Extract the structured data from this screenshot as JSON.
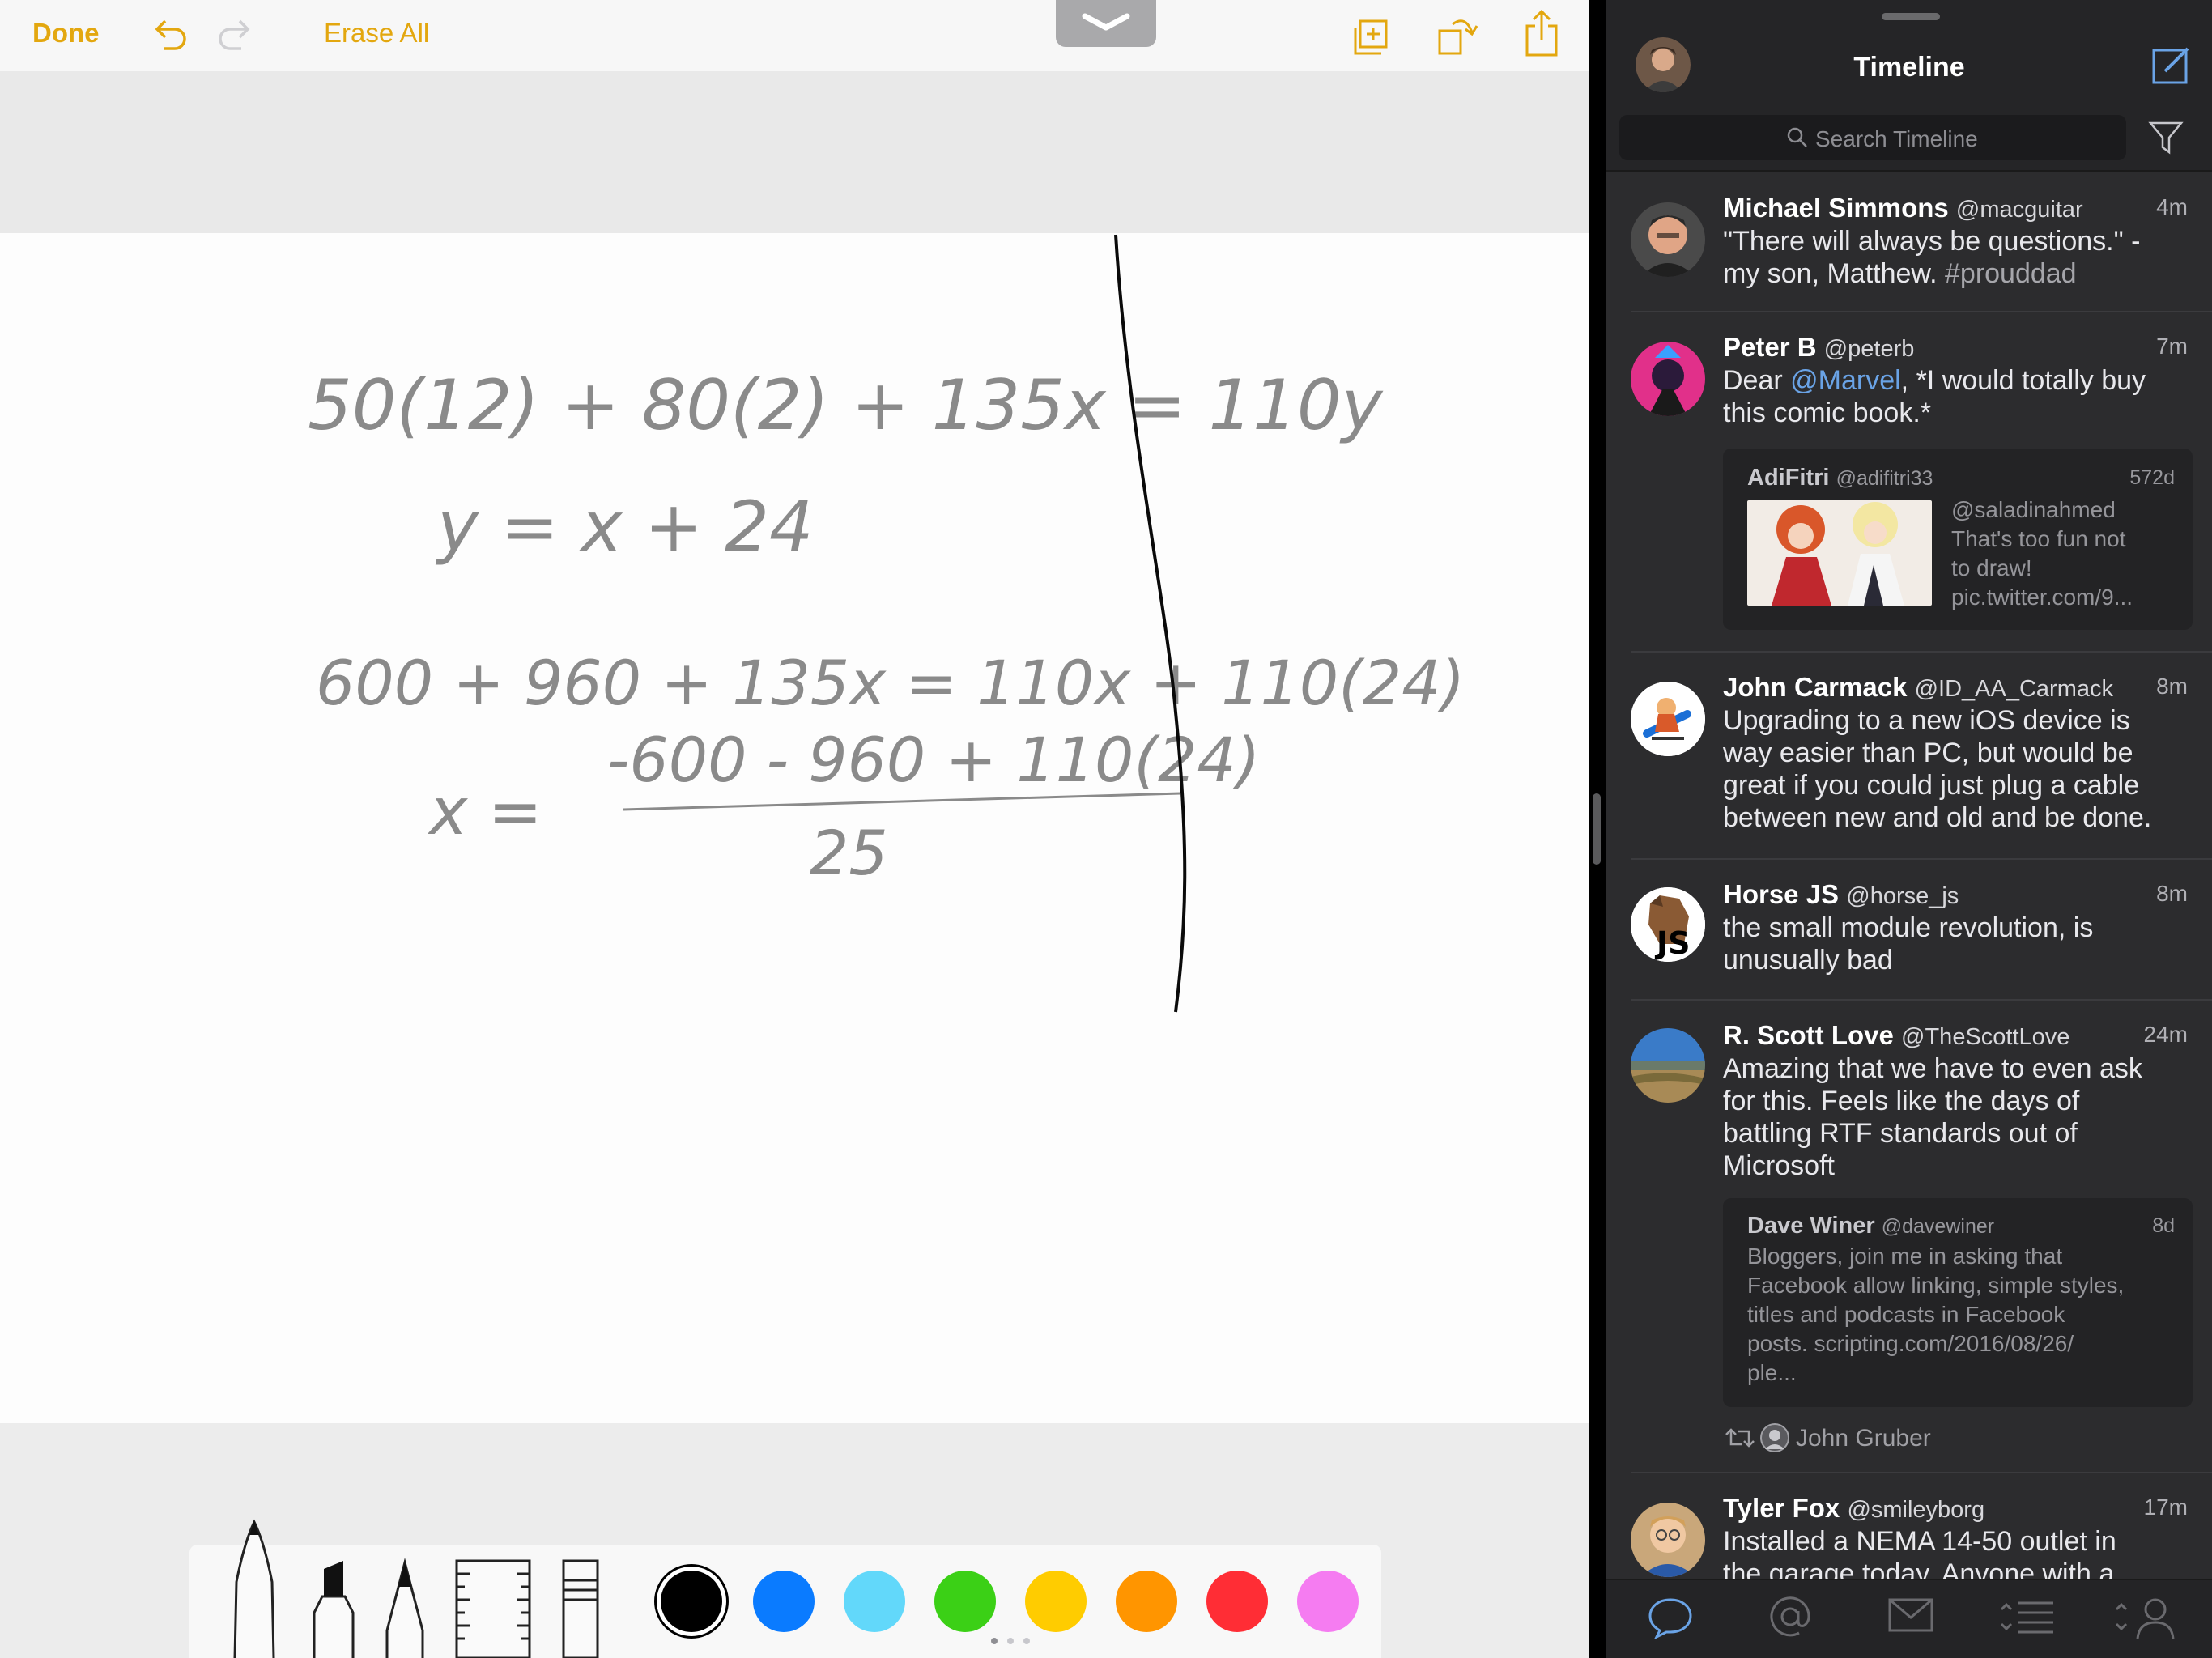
{
  "notes": {
    "toolbar": {
      "done_label": "Done",
      "erase_all_label": "Erase All",
      "accent_color": "#e3a70f"
    },
    "icons": [
      "undo-icon",
      "redo-icon",
      "add-page-icon",
      "rotate-icon",
      "share-icon",
      "chevron-down-icon"
    ],
    "handwriting": {
      "line1": "50(12) + 80(2) + 135x = 110y",
      "line2": "y = x + 24",
      "line3": "600 + 960 + 135x = 110x + 110(24)",
      "line4_numerator": "-600 - 960 + 110(24)",
      "line4_lhs": "x =",
      "line4_denominator": "25"
    },
    "tools": [
      "pen-tool",
      "marker-tool",
      "pencil-tool",
      "ruler-tool",
      "eraser-tool"
    ],
    "colors": [
      "#000000",
      "#0a7bff",
      "#62d8fa",
      "#3bd016",
      "#ffcc00",
      "#ff9500",
      "#ff2d35",
      "#f57cf1"
    ],
    "selected_color": "#000000"
  },
  "tweetbot": {
    "title": "Timeline",
    "search_placeholder": "Search Timeline",
    "tweets": [
      {
        "name": "Michael Simmons",
        "handle": "@macguitar",
        "time": "4m",
        "lines": [
          "\"There will always be questions.\" -",
          "my son, Matthew."
        ],
        "hashtag": "#prouddad"
      },
      {
        "name": "Peter B",
        "handle": "@peterb",
        "time": "7m",
        "line1_pre": "Dear ",
        "mention": "@Marvel",
        "line1_post": ", *I would totally buy",
        "line2": "this comic book.*",
        "quote": {
          "name": "AdiFitri",
          "handle": "@adifitri33",
          "time": "572d",
          "lines": [
            "@saladinahmed",
            "That's too fun not",
            "to draw!",
            "pic.twitter.com/9..."
          ]
        }
      },
      {
        "name": "John Carmack",
        "handle": "@ID_AA_Carmack",
        "time": "8m",
        "lines": [
          "Upgrading to a new iOS device is",
          "way easier than PC, but would be",
          "great if you could just plug a cable",
          "between new and old and be done."
        ]
      },
      {
        "name": "Horse JS",
        "handle": "@horse_js",
        "time": "8m",
        "lines": [
          "the small module revolution, is",
          "unusually bad"
        ]
      },
      {
        "name": "R. Scott Love",
        "handle": "@TheScottLove",
        "time": "24m",
        "lines": [
          "Amazing that we have to even ask",
          "for this.  Feels like the days of",
          "battling RTF standards out of",
          "Microsoft"
        ],
        "quote": {
          "name": "Dave Winer",
          "handle": "@davewiner",
          "time": "8d",
          "lines": [
            "Bloggers, join me in asking that",
            "Facebook allow linking, simple styles,",
            "titles and podcasts in Facebook",
            "posts. scripting.com/2016/08/26/",
            "ple..."
          ]
        },
        "retweeted_by": "John Gruber"
      },
      {
        "name": "Tyler Fox",
        "handle": "@smileyborg",
        "time": "17m",
        "lines": [
          "Installed a NEMA 14-50 outlet in",
          "the garage today. Anyone with a"
        ]
      }
    ],
    "tabs": [
      "timeline-tab",
      "mentions-tab",
      "messages-tab",
      "lists-tab",
      "profile-tab"
    ],
    "active_tab": "timeline-tab",
    "accent_color": "#6aa3e6"
  }
}
